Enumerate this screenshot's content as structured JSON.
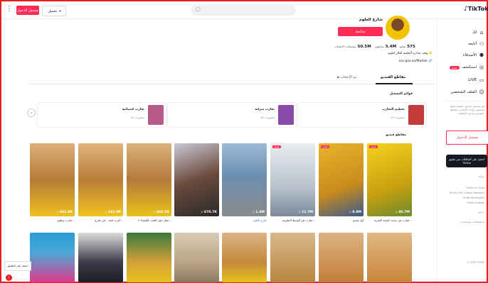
{
  "header": {
    "menu_icon": "more-vertical-icon",
    "login_label": "تسجيل الدخول",
    "upload_label": "تحميل",
    "upload_icon": "plus-icon",
    "search_placeholder": "",
    "search_icon": "search-icon",
    "logo_text": "TikTok",
    "logo_icon": "tiktok-note-icon"
  },
  "sidebar": {
    "items": [
      {
        "label": "لك",
        "icon": "home-icon"
      },
      {
        "label": "أتابعه",
        "icon": "following-icon"
      },
      {
        "label": "الأصدقاء",
        "icon": "friends-icon"
      },
      {
        "label": "استكشف",
        "icon": "explore-icon",
        "badge": "جديد"
      },
      {
        "label": "LIVE",
        "icon": "live-icon"
      },
      {
        "label": "الملف الشخصي",
        "icon": "profile-icon"
      }
    ],
    "login_prompt": "قم بتسجيل الدخول لمتابعة صناع المحتوى، وإبداء الإعجاب بمقاطع الفيديو، وعرض التعليقات.",
    "login_label": "تسجيل الدخول",
    "promo_text": "احصل على المكافآت عبر تطبيق TikTok",
    "footer_sections": [
      "شركة",
      "برنامج",
      "المصطلحات والسياسات"
    ],
    "footer_links": [
      "TikTok for Good",
      "TikTok LIVE Creator Networks",
      "TikTok Developers",
      "TikTok Embeds"
    ],
    "copyright": "© 2025 TikTok"
  },
  "profile": {
    "username": "شارع العلوم",
    "follow_label": "متابعة",
    "following_count": "575",
    "following_label": "متابَع",
    "followers_count": "5.4M",
    "followers_label": "متابعون",
    "likes_count": "50.5M",
    "likes_label": "تسجيلات الإعجاب",
    "bio": "وقف مبادرة العلمية أفكار لعلوم 🌟",
    "link": "sss.gov.sa/Madak"
  },
  "tabs": [
    {
      "label": "مقاطع الفيديو",
      "active": true
    },
    {
      "label": "تم الإعجاب",
      "active": false
    }
  ],
  "playlists_title": "قوائم التشغيل",
  "playlists": [
    {
      "title": "تحطيم التجارب",
      "count": "23 منشورات",
      "color": "#c23b3b"
    },
    {
      "title": "تجارب منزلية",
      "count": "18 منشورات",
      "color": "#8a4aa8"
    },
    {
      "title": "تجارب كيميائية",
      "count": "16 منشورات",
      "color": "#b85a8a"
    }
  ],
  "videos_title": "مقاطع فيديو",
  "videos_row1": [
    {
      "views": "40.7M",
      "caption": "تجارب في سحب لنتيجة التجربة...",
      "pinned": "مثبت",
      "bg": "#e8c21a"
    },
    {
      "views": "8.9M",
      "caption": "أول فيديو",
      "pinned": "مثبت",
      "bg": "#d9a21a"
    },
    {
      "views": "11.7M",
      "caption": "تجارب في الوسط التطريف...",
      "pinned": "مثبت",
      "bg": "#c9cfd6"
    },
    {
      "views": "1.4M",
      "caption": "شارع العلوم",
      "pinned": "",
      "bg": "#6c8fb1"
    },
    {
      "views": "670.7K",
      "caption": "",
      "pinned": "",
      "bg": "#6b4a3c"
    },
    {
      "views": "200.5K",
      "caption": "عمل حول اللعب بالكيمياء 1...",
      "pinned": "",
      "bg": "#b57a3b"
    },
    {
      "views": "242.9K",
      "caption": "أجرب لعبة... في شارع...",
      "pinned": "",
      "bg": "#b97d3a"
    },
    {
      "views": "402.8K",
      "caption": "تجارب وعلوم...",
      "pinned": "",
      "bg": "#b67b38"
    }
  ],
  "videos_row2": [
    {
      "bg": "#c9853a"
    },
    {
      "bg": "#c27f39"
    },
    {
      "bg": "#b8863f"
    },
    {
      "bg": "#c4883c"
    },
    {
      "bg": "#b9a485"
    },
    {
      "bg": "#d4a03a"
    },
    {
      "bg": "#3b3b4a"
    },
    {
      "bg": "#4aa8d8"
    }
  ],
  "get_app_label": "احصل على التطبيق"
}
